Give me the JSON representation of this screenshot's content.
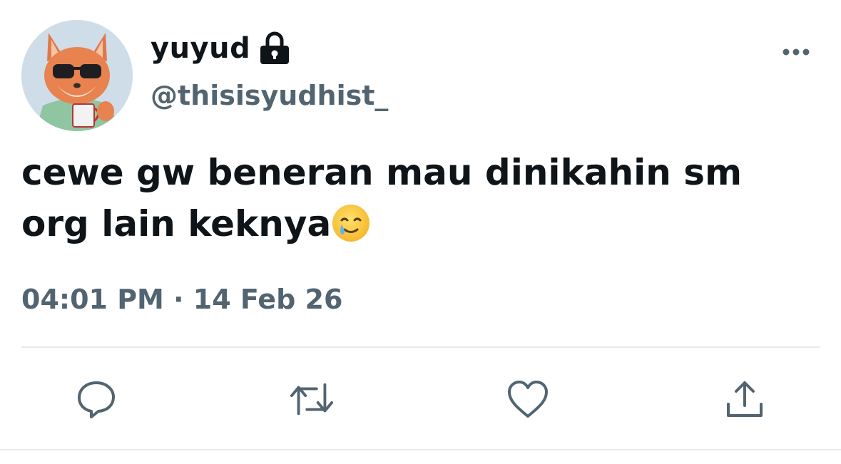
{
  "user": {
    "display_name": "yuyud",
    "handle": "@thisisyudhist_",
    "avatar_icon": "fox-avatar",
    "protected_icon": "lock-icon"
  },
  "tweet": {
    "line1": "cewe gw beneran mau dinikahin sm",
    "line2": "org lain keknya",
    "emoji": "smiling-face-with-tear",
    "time": "04:01 PM",
    "separator": "·",
    "date": "14 Feb 26"
  },
  "actions": [
    {
      "name": "reply",
      "icon": "speech-bubble-icon"
    },
    {
      "name": "retweet",
      "icon": "retweet-icon"
    },
    {
      "name": "like",
      "icon": "heart-icon"
    },
    {
      "name": "share",
      "icon": "share-icon"
    }
  ],
  "colors": {
    "text": "#0f1419",
    "secondary": "#536471",
    "divider": "#e6ebef"
  }
}
